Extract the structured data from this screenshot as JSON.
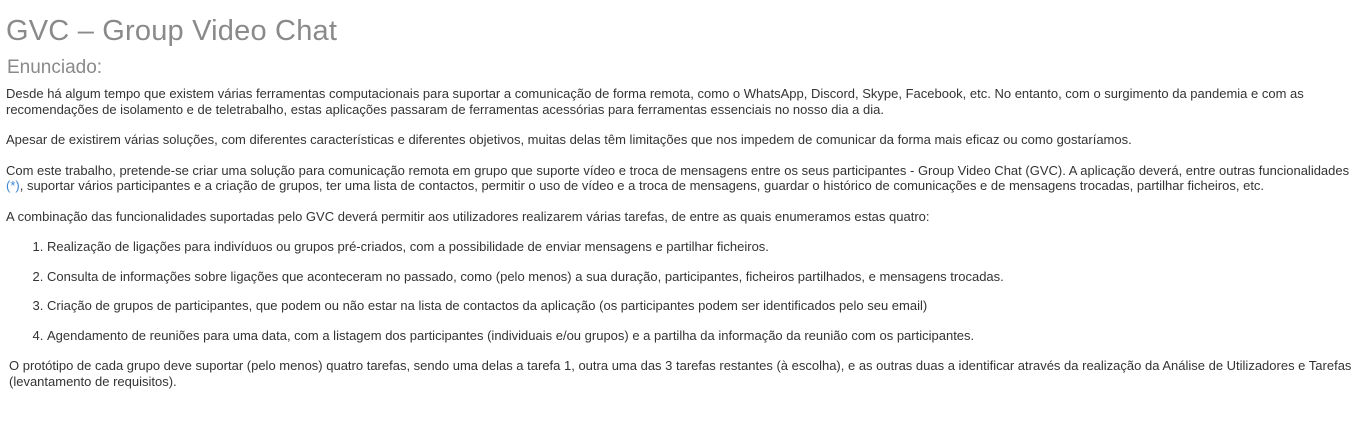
{
  "title": "GVC – Group Video Chat",
  "subtitle": "Enunciado:",
  "paragraphs": {
    "p1": "Desde há algum tempo que existem várias ferramentas computacionais para suportar a comunicação de forma remota, como o WhatsApp, Discord, Skype, Facebook, etc. No entanto, com o surgimento da pandemia e com as recomendações de isolamento e de teletrabalho, estas aplicações passaram de ferramentas acessórias para ferramentas essenciais no nosso dia a dia.",
    "p2": "Apesar de existirem várias soluções, com diferentes características e diferentes objetivos, muitas delas têm limitações que nos impedem de comunicar da forma mais eficaz ou como gostaríamos.",
    "p3_before": "Com este trabalho, pretende-se criar uma solução para comunicação remota em grupo que suporte vídeo e troca de mensagens entre os seus participantes - Group Video Chat (GVC). A aplicação deverá, entre outras funcionalidades ",
    "p3_link": "(*)",
    "p3_after": ", suportar vários participantes e a criação de grupos, ter uma lista de contactos, permitir o uso de vídeo e a troca de mensagens, guardar o histórico de comunicações e de mensagens trocadas, partilhar ficheiros, etc.",
    "p4": "A combinação das funcionalidades suportadas pelo GVC deverá permitir aos utilizadores realizarem várias tarefas, de entre as quais enumeramos estas quatro:",
    "p5": "O protótipo de cada grupo deve suportar (pelo menos) quatro tarefas, sendo uma delas a tarefa 1, outra uma das 3 tarefas restantes (à escolha), e as outras duas a identificar através da realização da Análise de Utilizadores e Tarefas (levantamento de requisitos)."
  },
  "tasks": [
    "Realização de ligações para indivíduos ou grupos pré-criados, com a possibilidade de enviar mensagens e partilhar ficheiros.",
    "Consulta de informações sobre ligações que aconteceram no passado, como (pelo menos) a sua duração, participantes, ficheiros partilhados, e mensagens trocadas.",
    "Criação de grupos de participantes, que podem ou não estar na lista de contactos da aplicação (os participantes podem ser identificados pelo seu email)",
    "Agendamento de reuniões para uma data, com a listagem dos participantes (individuais e/ou grupos) e a partilha da informação da reunião com os participantes."
  ],
  "colors": {
    "heading": "#8a8a8a",
    "text": "#333333",
    "link": "#3a87d6"
  }
}
